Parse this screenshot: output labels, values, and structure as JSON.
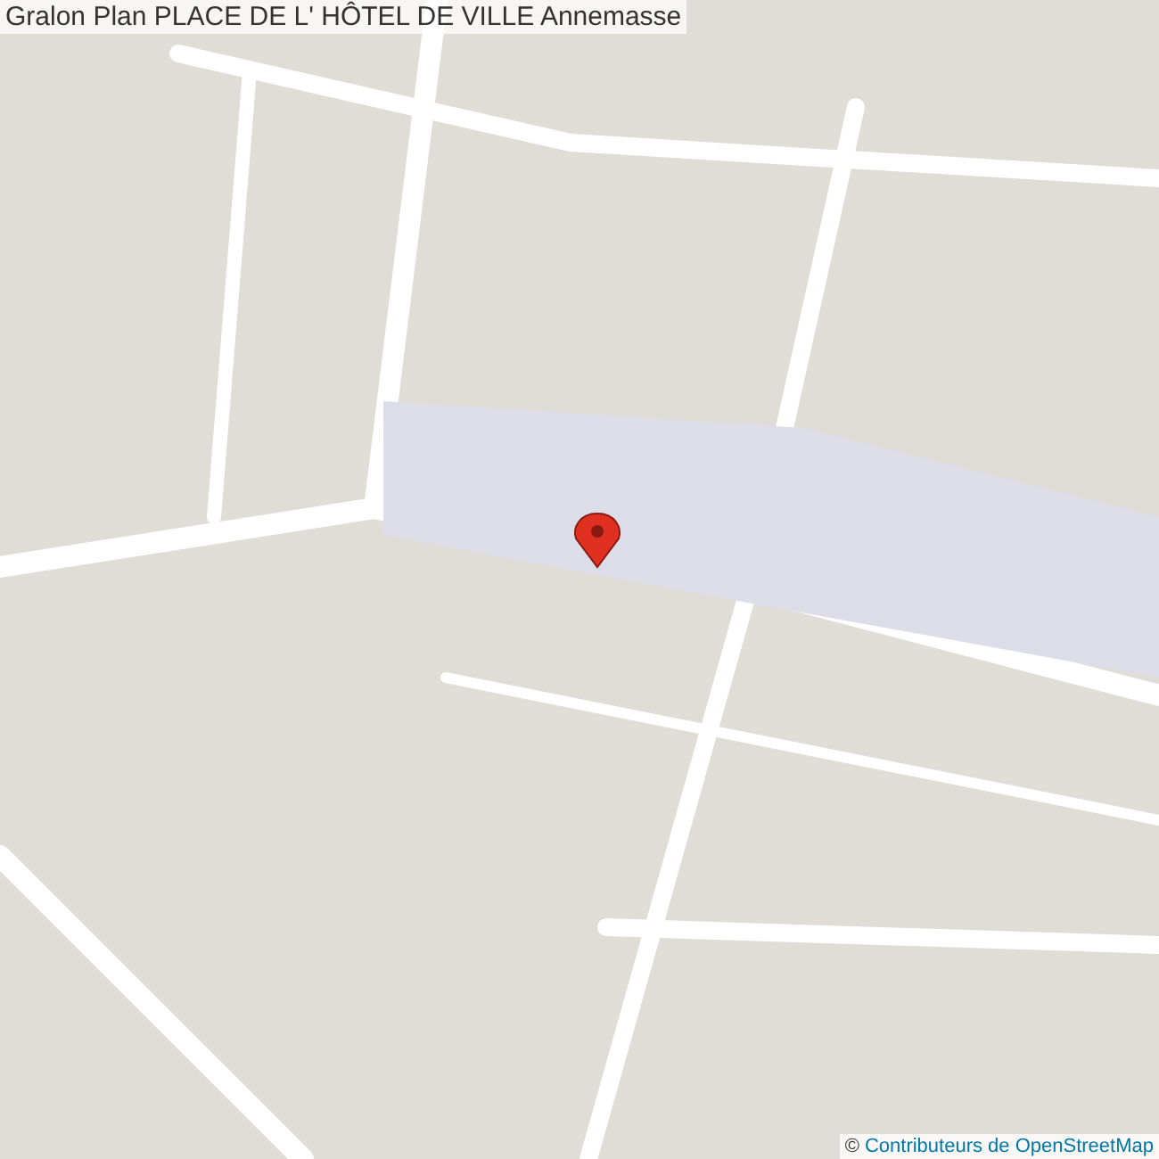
{
  "title": "Gralon Plan PLACE DE L' HÔTEL DE VILLE Annemasse",
  "attribution": {
    "symbol": "©",
    "link": "Contributeurs de OpenStreetMap"
  }
}
